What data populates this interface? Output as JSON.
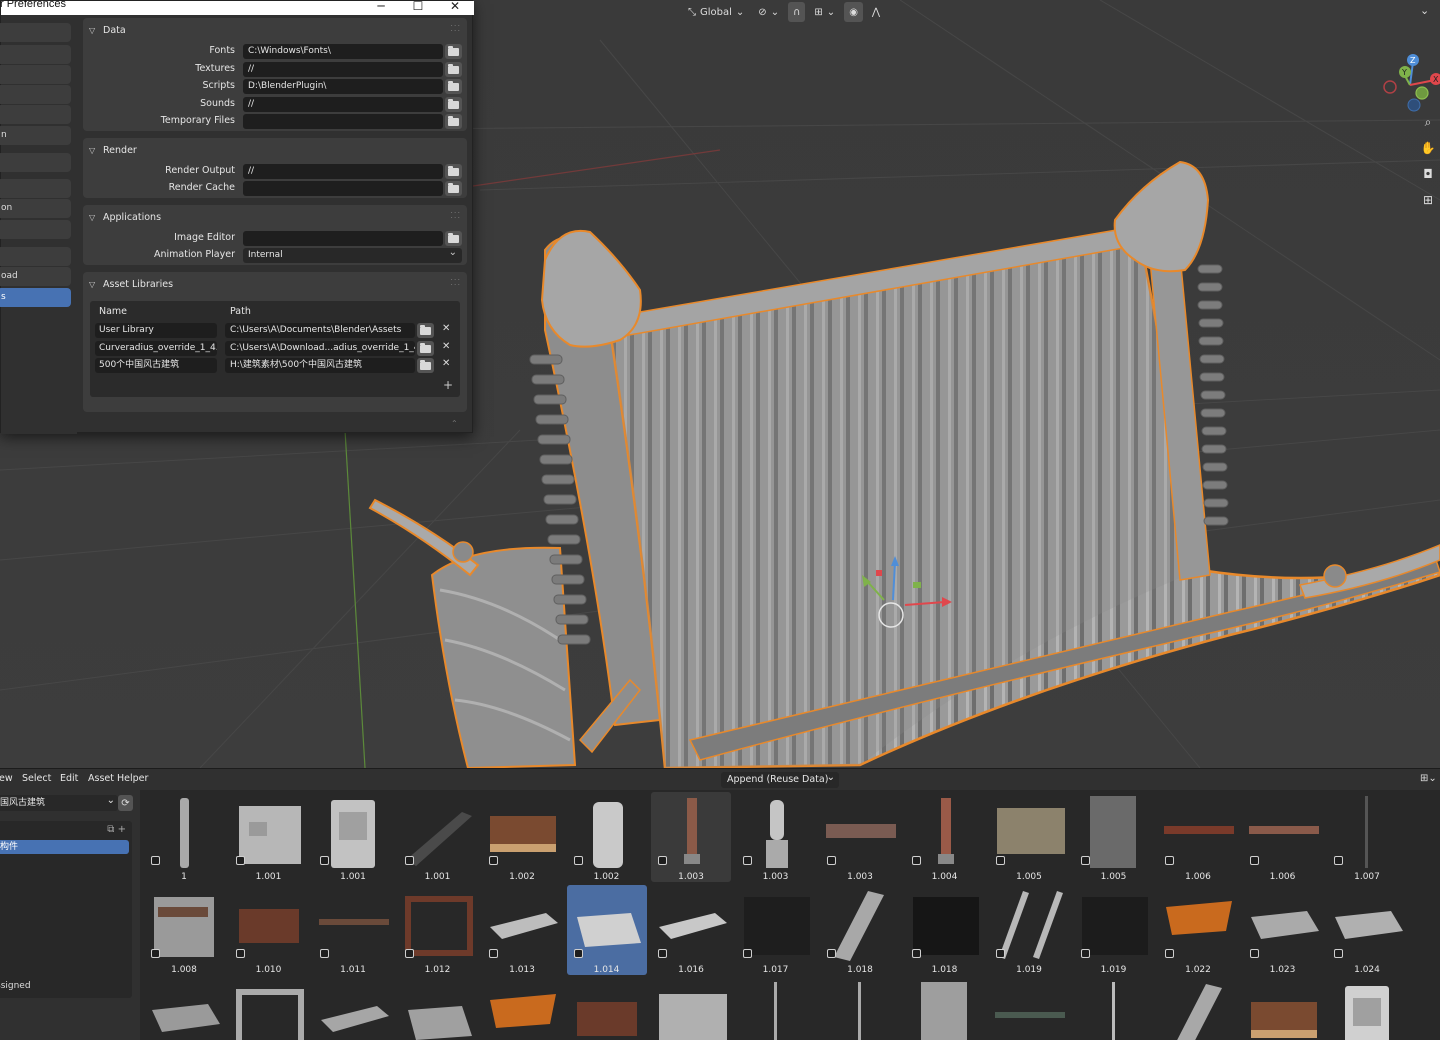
{
  "viewport": {
    "transform_orientation": "Global",
    "header_icons": [
      "pivot-icon",
      "link-icon",
      "snap-icon",
      "snap-increment-icon",
      "proportional-edit-icon",
      "falloff-icon"
    ],
    "nav_tools": [
      "zoom-icon",
      "pan-icon",
      "camera-icon",
      "grid-icon"
    ],
    "gizmo_axes": [
      "Z",
      "Y",
      "X"
    ],
    "selection_color": "#e8892b",
    "mesh_color": "#9b9b9b",
    "background_color": "#3b3b3b"
  },
  "preferences": {
    "window_title": "r Preferences",
    "controls": [
      "minimize-icon",
      "maximize-icon",
      "close-icon"
    ],
    "sidebar": {
      "items": [
        {
          "label": "",
          "selected": false
        },
        {
          "label": "",
          "selected": false
        },
        {
          "label": "",
          "selected": false
        },
        {
          "label": "",
          "selected": false
        },
        {
          "label": "",
          "selected": false
        },
        {
          "label": "n",
          "selected": false
        },
        {
          "label": "",
          "selected": false
        },
        {
          "label": "",
          "selected": false
        },
        {
          "label": "on",
          "selected": false
        },
        {
          "label": "",
          "selected": false
        },
        {
          "label": "",
          "selected": false
        },
        {
          "label": "oad",
          "selected": false
        },
        {
          "label": "s",
          "selected": true
        }
      ]
    },
    "sections": {
      "data": {
        "title": "Data",
        "rows": [
          {
            "label": "Fonts",
            "value": "C:\\Windows\\Fonts\\"
          },
          {
            "label": "Textures",
            "value": "//"
          },
          {
            "label": "Scripts",
            "value": "D:\\BlenderPlugin\\"
          },
          {
            "label": "Sounds",
            "value": "//"
          },
          {
            "label": "Temporary Files",
            "value": ""
          }
        ]
      },
      "render": {
        "title": "Render",
        "rows": [
          {
            "label": "Render Output",
            "value": "//"
          },
          {
            "label": "Render Cache",
            "value": ""
          }
        ]
      },
      "applications": {
        "title": "Applications",
        "image_editor_label": "Image Editor",
        "image_editor_value": "",
        "animation_player_label": "Animation Player",
        "animation_player_value": "Internal"
      },
      "asset_libraries": {
        "title": "Asset Libraries",
        "col_name": "Name",
        "col_path": "Path",
        "libraries": [
          {
            "name": "User Library",
            "path": "C:\\Users\\A\\Documents\\Blender\\Assets"
          },
          {
            "name": "Curveradius_override_1_4...",
            "path": "C:\\Users\\A\\Download...adius_override_1_4_6"
          },
          {
            "name": "500个中国风古建筑",
            "path": "H:\\建筑素材\\500个中国风古建筑"
          }
        ],
        "add_label": "+",
        "remove_label": "✕"
      }
    }
  },
  "asset_browser": {
    "menus": [
      "ew",
      "Select",
      "Edit",
      "Asset Helper"
    ],
    "import_method": "Append (Reuse Data)",
    "library_selected": "国风古建筑",
    "catalog_selected": "构件",
    "catalog_unassigned": "ssigned",
    "rows": [
      [
        "1",
        "1.001",
        "1.001",
        "1.001",
        "1.002",
        "1.002",
        "1.003",
        "1.003",
        "1.003",
        "1.004",
        "1.005",
        "1.005",
        "1.006",
        "1.006",
        "1.007"
      ],
      [
        "1.008",
        "1.010",
        "1.011",
        "1.012",
        "1.013",
        "1.014",
        "1.016",
        "1.017",
        "1.018",
        "1.018",
        "1.019",
        "1.019",
        "1.022",
        "1.023",
        "1.024"
      ]
    ],
    "selected_asset": "1.014",
    "hovered_asset": "1.003"
  }
}
